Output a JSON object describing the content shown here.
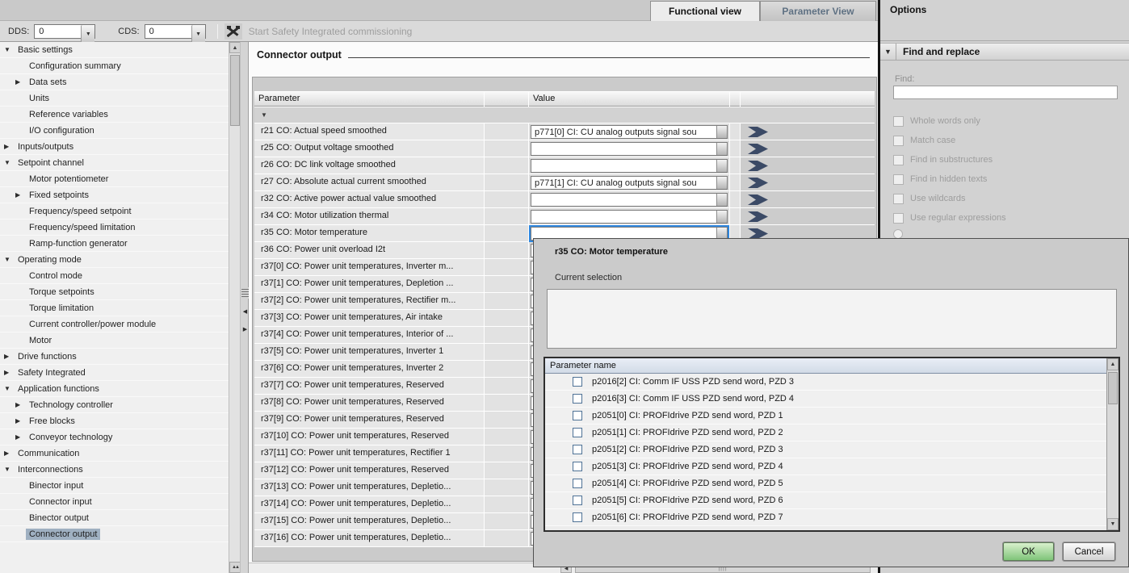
{
  "window": {
    "tabs": [
      {
        "label": "Functional view",
        "active": true
      },
      {
        "label": "Parameter View",
        "active": false
      }
    ],
    "options_title": "Options"
  },
  "toolbar": {
    "dds_label": "DDS:",
    "dds_value": "0",
    "cds_label": "CDS:",
    "cds_value": "0",
    "safety_button": "Start Safety Integrated commissioning"
  },
  "sidebar": {
    "items": [
      {
        "label": "Basic settings",
        "level": 0,
        "state": "expanded"
      },
      {
        "label": "Configuration summary",
        "level": 1,
        "state": "leaf"
      },
      {
        "label": "Data sets",
        "level": 1,
        "state": "collapsed"
      },
      {
        "label": "Units",
        "level": 1,
        "state": "leaf"
      },
      {
        "label": "Reference variables",
        "level": 1,
        "state": "leaf"
      },
      {
        "label": "I/O configuration",
        "level": 1,
        "state": "leaf"
      },
      {
        "label": "Inputs/outputs",
        "level": 0,
        "state": "collapsed"
      },
      {
        "label": "Setpoint channel",
        "level": 0,
        "state": "expanded"
      },
      {
        "label": "Motor potentiometer",
        "level": 1,
        "state": "leaf"
      },
      {
        "label": "Fixed setpoints",
        "level": 1,
        "state": "collapsed"
      },
      {
        "label": "Frequency/speed setpoint",
        "level": 1,
        "state": "leaf"
      },
      {
        "label": "Frequency/speed limitation",
        "level": 1,
        "state": "leaf"
      },
      {
        "label": "Ramp-function generator",
        "level": 1,
        "state": "leaf"
      },
      {
        "label": "Operating mode",
        "level": 0,
        "state": "expanded"
      },
      {
        "label": "Control mode",
        "level": 1,
        "state": "leaf"
      },
      {
        "label": "Torque setpoints",
        "level": 1,
        "state": "leaf"
      },
      {
        "label": "Torque limitation",
        "level": 1,
        "state": "leaf"
      },
      {
        "label": "Current controller/power module",
        "level": 1,
        "state": "leaf"
      },
      {
        "label": "Motor",
        "level": 1,
        "state": "leaf"
      },
      {
        "label": "Drive functions",
        "level": 0,
        "state": "collapsed"
      },
      {
        "label": "Safety Integrated",
        "level": 0,
        "state": "collapsed"
      },
      {
        "label": "Application functions",
        "level": 0,
        "state": "expanded"
      },
      {
        "label": "Technology controller",
        "level": 1,
        "state": "collapsed"
      },
      {
        "label": "Free blocks",
        "level": 1,
        "state": "collapsed"
      },
      {
        "label": "Conveyor technology",
        "level": 1,
        "state": "collapsed"
      },
      {
        "label": "Communication",
        "level": 0,
        "state": "collapsed"
      },
      {
        "label": "Interconnections",
        "level": 0,
        "state": "expanded"
      },
      {
        "label": "Binector input",
        "level": 1,
        "state": "leaf"
      },
      {
        "label": "Connector input",
        "level": 1,
        "state": "leaf"
      },
      {
        "label": "Binector output",
        "level": 1,
        "state": "leaf"
      },
      {
        "label": "Connector output",
        "level": 1,
        "state": "leaf",
        "selected": true
      }
    ]
  },
  "main": {
    "title": "Connector output",
    "table": {
      "parameter_header": "Parameter",
      "value_header": "Value",
      "rows": [
        {
          "param": "r21 CO: Actual speed smoothed",
          "value": "p771[0] CI: CU analog outputs signal sou"
        },
        {
          "param": "r25 CO: Output voltage smoothed",
          "value": ""
        },
        {
          "param": "r26 CO: DC link voltage smoothed",
          "value": ""
        },
        {
          "param": "r27 CO: Absolute actual current smoothed",
          "value": "p771[1] CI: CU analog outputs signal sou"
        },
        {
          "param": "r32 CO: Active power actual value smoothed",
          "value": ""
        },
        {
          "param": "r34 CO: Motor utilization thermal",
          "value": ""
        },
        {
          "param": "r35 CO: Motor temperature",
          "value": "",
          "focused": true
        },
        {
          "param": "r36 CO: Power unit overload I2t",
          "value": ""
        },
        {
          "param": "r37[0] CO: Power unit temperatures, Inverter m...",
          "value": ""
        },
        {
          "param": "r37[1] CO: Power unit temperatures, Depletion ...",
          "value": ""
        },
        {
          "param": "r37[2] CO: Power unit temperatures, Rectifier m...",
          "value": ""
        },
        {
          "param": "r37[3] CO: Power unit temperatures, Air intake",
          "value": ""
        },
        {
          "param": "r37[4] CO: Power unit temperatures, Interior of ...",
          "value": ""
        },
        {
          "param": "r37[5] CO: Power unit temperatures, Inverter 1",
          "value": ""
        },
        {
          "param": "r37[6] CO: Power unit temperatures, Inverter 2",
          "value": ""
        },
        {
          "param": "r37[7] CO: Power unit temperatures, Reserved",
          "value": ""
        },
        {
          "param": "r37[8] CO: Power unit temperatures, Reserved",
          "value": ""
        },
        {
          "param": "r37[9] CO: Power unit temperatures, Reserved",
          "value": ""
        },
        {
          "param": "r37[10] CO: Power unit temperatures, Reserved",
          "value": ""
        },
        {
          "param": "r37[11] CO: Power unit temperatures, Rectifier 1",
          "value": ""
        },
        {
          "param": "r37[12] CO: Power unit temperatures, Reserved",
          "value": ""
        },
        {
          "param": "r37[13] CO: Power unit temperatures, Depletio...",
          "value": ""
        },
        {
          "param": "r37[14] CO: Power unit temperatures, Depletio...",
          "value": ""
        },
        {
          "param": "r37[15] CO: Power unit temperatures, Depletio...",
          "value": ""
        },
        {
          "param": "r37[16] CO: Power unit temperatures, Depletio...",
          "value": ""
        }
      ]
    }
  },
  "dialog": {
    "title": "r35 CO: Motor temperature",
    "current_selection_label": "Current selection",
    "list_header": "Parameter name",
    "items": [
      {
        "label": "p2016[2] CI: Comm IF USS PZD send word, PZD 3"
      },
      {
        "label": "p2016[3] CI: Comm IF USS PZD send word, PZD 4"
      },
      {
        "label": "p2051[0] CI: PROFIdrive PZD send word, PZD 1"
      },
      {
        "label": "p2051[1] CI: PROFIdrive PZD send word, PZD 2"
      },
      {
        "label": "p2051[2] CI: PROFIdrive PZD send word, PZD 3"
      },
      {
        "label": "p2051[3] CI: PROFIdrive PZD send word, PZD 4"
      },
      {
        "label": "p2051[4] CI: PROFIdrive PZD send word, PZD 5"
      },
      {
        "label": "p2051[5] CI: PROFIdrive PZD send word, PZD 6"
      },
      {
        "label": "p2051[6] CI: PROFIdrive PZD send word, PZD 7"
      }
    ],
    "ok_label": "OK",
    "cancel_label": "Cancel"
  },
  "find_panel": {
    "title": "Find and replace",
    "find_label": "Find:",
    "find_value": "",
    "checkboxes": [
      {
        "label": "Whole words only"
      },
      {
        "label": "Match case"
      },
      {
        "label": "Find in substructures"
      },
      {
        "label": "Find in hidden texts"
      },
      {
        "label": "Use wildcards"
      },
      {
        "label": "Use regular expressions"
      }
    ]
  },
  "colors": {
    "focus_blue": "#2e86de",
    "tree_selection": "#9fb0c1",
    "arrow_navy": "#3b4a66",
    "ok_green": "#7fc479"
  }
}
